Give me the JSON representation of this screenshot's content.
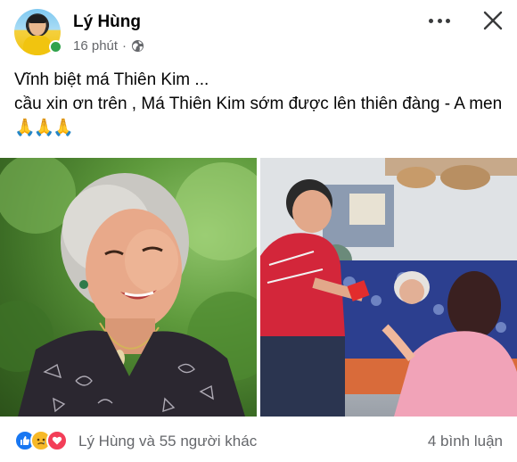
{
  "post": {
    "author": "Lý Hùng",
    "time": "16 phút",
    "separator": "·",
    "privacy_icon": "globe-icon",
    "line1": "Vĩnh biệt má Thiên Kim ...",
    "line2": "cầu xin ơn trên , Má Thiên Kim sớm được lên thiên đàng - A men",
    "emoji": "🙏🙏🙏"
  },
  "header": {
    "more_icon": "more-horizontal-icon",
    "close_icon": "close-icon"
  },
  "photos": [
    {
      "name": "photo-portrait-elderly-woman"
    },
    {
      "name": "photo-visit-bedside"
    }
  ],
  "footer": {
    "reactions": [
      "like-icon",
      "sad-icon",
      "love-icon"
    ],
    "reaction_text": "Lý Hùng và 55 người khác",
    "comments_text": "4 bình luận"
  },
  "colors": {
    "text_primary": "#050505",
    "text_secondary": "#65676b",
    "like": "#1877f2",
    "sad": "#f7b928",
    "love": "#f33e58",
    "online": "#31a24c"
  }
}
